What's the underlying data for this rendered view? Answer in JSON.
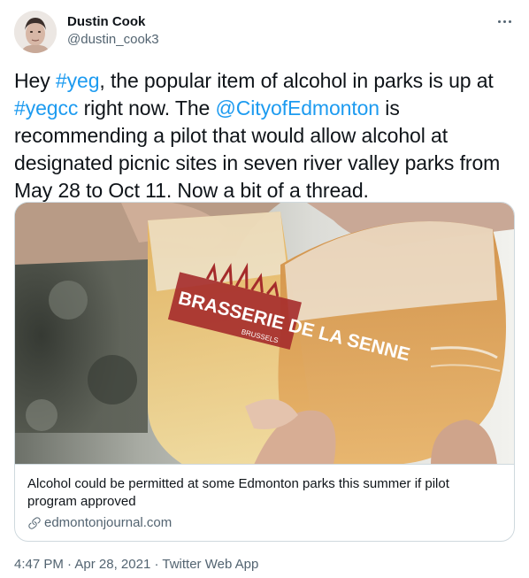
{
  "author": {
    "display_name": "Dustin Cook",
    "handle": "@dustin_cook3",
    "avatar_icon": "profile-photo"
  },
  "more_icon": "ellipsis-icon",
  "tweet": {
    "lines": [
      [
        {
          "text": "Hey ",
          "type": "text"
        },
        {
          "text": "#yeg",
          "type": "hashtag"
        },
        {
          "text": ", the popular item of alcohol in parks is up at",
          "type": "text"
        }
      ],
      [
        {
          "text": "#yegcc",
          "type": "hashtag"
        },
        {
          "text": " right now. The ",
          "type": "text"
        },
        {
          "text": "@CityofEdmonton",
          "type": "mention"
        },
        {
          "text": " is",
          "type": "text"
        }
      ],
      [
        {
          "text": "recommending a pilot that would allow alcohol at",
          "type": "text"
        }
      ],
      [
        {
          "text": "designated picnic sites in seven river valley parks from",
          "type": "text"
        }
      ],
      [
        {
          "text": "May 28 to Oct 11. Now a bit of a thread.",
          "type": "text"
        }
      ]
    ]
  },
  "card": {
    "image_glass_text": "BRASSERIE DE LA SENNE",
    "image_glass_subtext": "BRUSSELS",
    "title": "Alcohol could be permitted at some Edmonton parks this summer if pilot program approved",
    "domain": "edmontonjournal.com",
    "domain_icon": "link-icon"
  },
  "footer": {
    "time": "4:47 PM",
    "separator": "·",
    "date": "Apr 28, 2021",
    "source": "Twitter Web App"
  },
  "colors": {
    "link": "#1d9bf0",
    "secondary_text": "#536471",
    "border": "#cfd9de"
  }
}
